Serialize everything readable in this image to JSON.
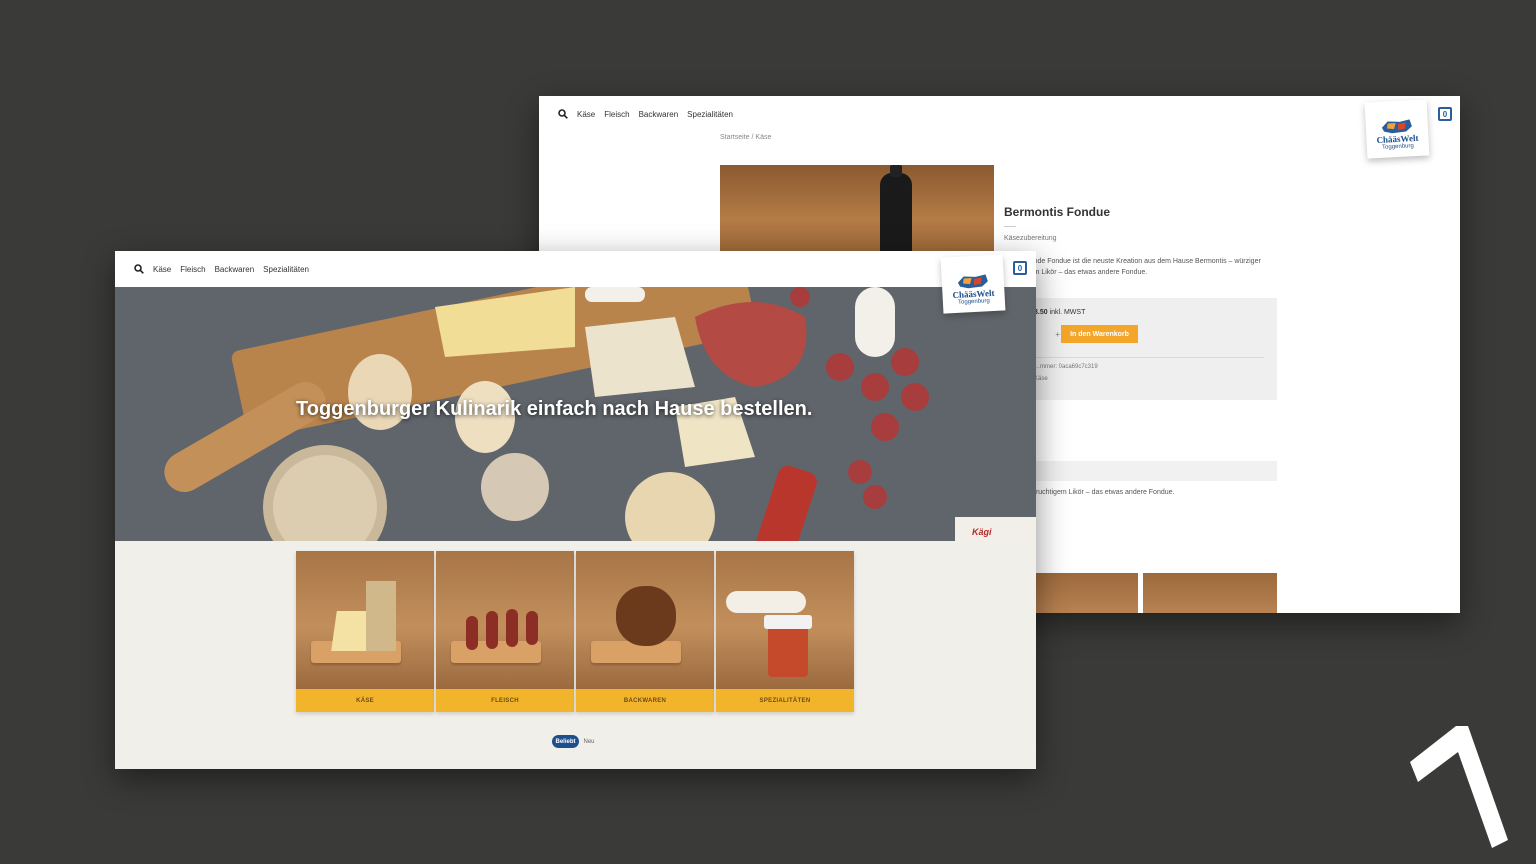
{
  "nav": {
    "items": [
      "Käse",
      "Fleisch",
      "Backwaren",
      "Spezialitäten"
    ]
  },
  "logo": {
    "line1": "ChääsWelt",
    "line2": "Toggenburg"
  },
  "cart": {
    "count": "0"
  },
  "product_page": {
    "breadcrumb": "Startseite  /  Käse",
    "title": "Bermontis Fondue",
    "category": "Käsezubereitung",
    "description": "…hmelzende Fondue ist die neuste Kreation aus dem Hause Bermontis – würziger …uchtigem Likör – das etwas andere Fondue.",
    "price": "3.50",
    "price_note": "inkl. MWST",
    "qty_button": "+",
    "add_to_cart": "In den Warenkorb",
    "sku": "…mmer: 0aca69c7c319",
    "category_line": "Käse",
    "description_repeat": "fruchtigem Likör – das etwas andere Fondue."
  },
  "home": {
    "hero_title": "Toggenburger Kulinarik einfach nach Hause bestellen.",
    "categories": [
      {
        "label": "KÄSE"
      },
      {
        "label": "FLEISCH"
      },
      {
        "label": "BACKWAREN"
      },
      {
        "label": "SPEZIALITÄTEN"
      }
    ],
    "filter_tabs": [
      "Beliebt",
      "Neu"
    ],
    "hero_brand_text": "Kägi"
  },
  "colors": {
    "accent_yellow": "#f2b42b",
    "brand_blue": "#1d4f8f",
    "button_orange": "#f4a62a",
    "background": "#3a3a38"
  }
}
